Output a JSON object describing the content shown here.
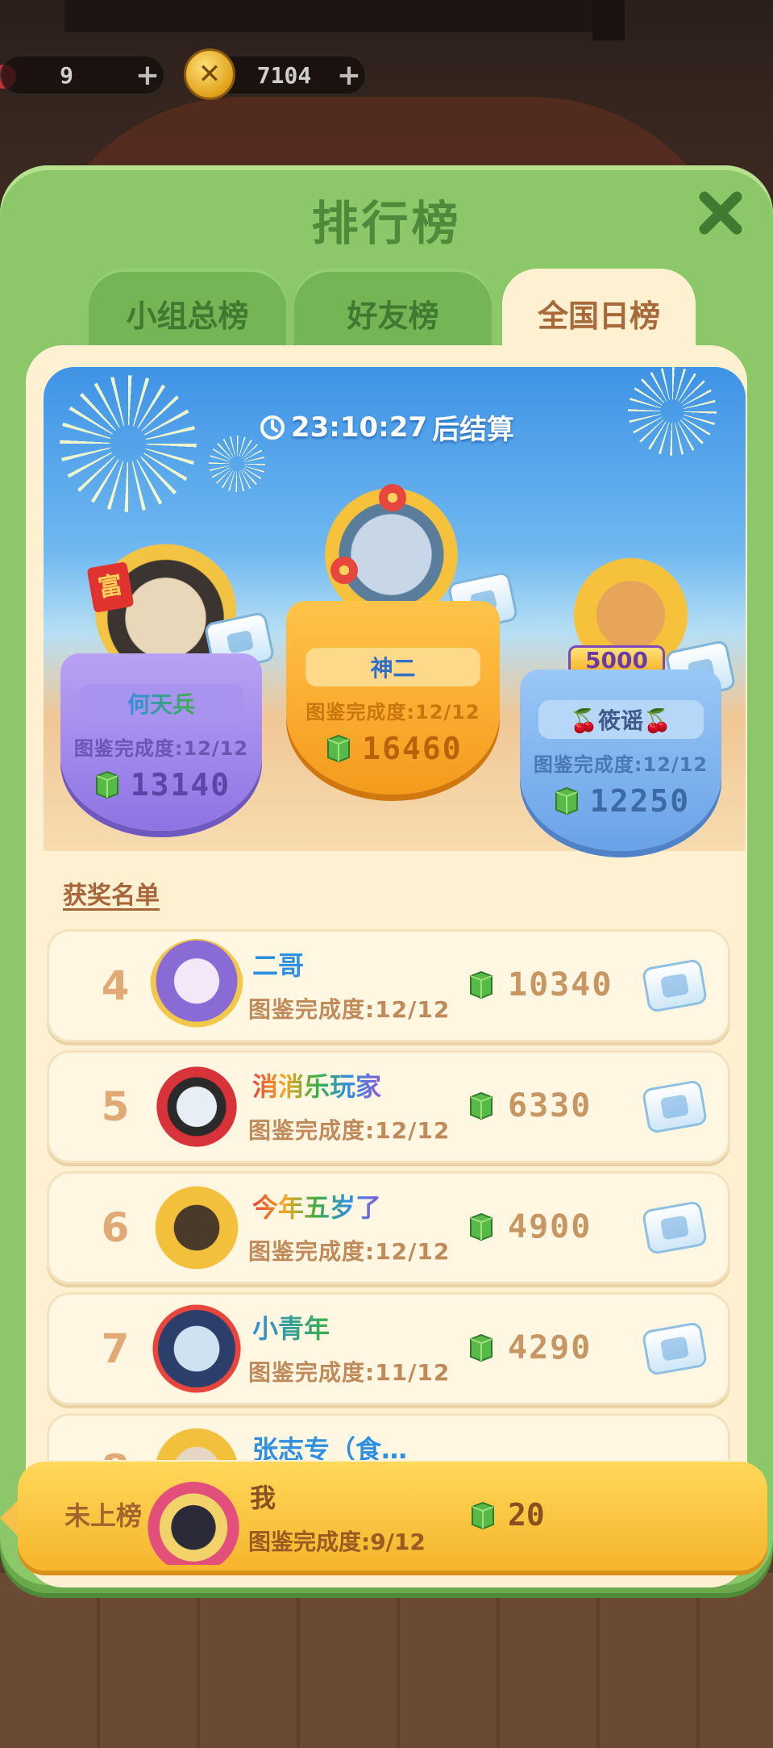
{
  "resources": [
    {
      "value": "9",
      "plus": "+"
    },
    {
      "value": "7104",
      "plus": "+"
    }
  ],
  "panel": {
    "title": "排行榜"
  },
  "tabs": [
    {
      "label": "小组总榜",
      "active": false
    },
    {
      "label": "好友榜",
      "active": false
    },
    {
      "label": "全国日榜",
      "active": true
    }
  ],
  "timer": {
    "time": "23:10:27",
    "suffix": "后结算"
  },
  "podium": [
    {
      "rank": 2,
      "name": "何天兵",
      "completion": "图鉴完成度:12/12",
      "score": "13140",
      "color": "#8e74e4"
    },
    {
      "rank": 1,
      "name": "神二",
      "completion": "图鉴完成度:12/12",
      "score": "16460",
      "color": "#f59a1c"
    },
    {
      "rank": 3,
      "name": "🍒筱谣🍒",
      "completion": "图鉴完成度:12/12",
      "score": "12250",
      "color": "#6aa2e8"
    }
  ],
  "podium_badges": {
    "fu": "富",
    "bonus": "5000"
  },
  "award_list": {
    "title": "获奖名单",
    "rows": [
      {
        "rank": "4",
        "name": "二哥",
        "completion": "图鉴完成度:12/12",
        "score": "10340",
        "name_style": "blue"
      },
      {
        "rank": "5",
        "name": "消消乐玩家",
        "completion": "图鉴完成度:12/12",
        "score": "6330",
        "name_style": "rainbow"
      },
      {
        "rank": "6",
        "name": "今年五岁了",
        "completion": "图鉴完成度:12/12",
        "score": "4900",
        "name_style": "rainbow"
      },
      {
        "rank": "7",
        "name": "小青年",
        "completion": "图鉴完成度:11/12",
        "score": "4290",
        "name_style": "blue-green"
      },
      {
        "rank": "8",
        "name": "张志专（食…",
        "completion": "",
        "score": "",
        "name_style": "blue"
      }
    ]
  },
  "my_rank": {
    "rank_text": "未上榜",
    "name": "我",
    "completion": "图鉴完成度:9/12",
    "score": "20"
  },
  "colors": {
    "panel_green": "#8cc86a",
    "inner_beige": "#fdf1d2",
    "banner_yellow": "#f6b52c",
    "gem_green": "#4caf50"
  },
  "icons": {
    "close": "close-icon",
    "clock": "clock-icon",
    "gem": "green-gem-icon",
    "reward": "reward-box-icon"
  }
}
